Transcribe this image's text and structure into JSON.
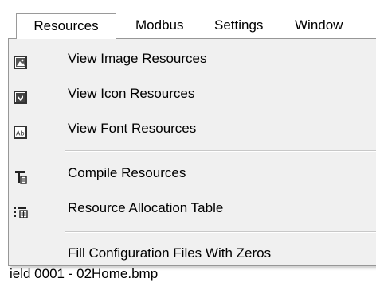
{
  "menubar": {
    "items": [
      "Resources",
      "Modbus",
      "Settings",
      "Window"
    ]
  },
  "background": {
    "partial_text": "ield 0001 - 02Home.bmp"
  },
  "dropdown": {
    "items": [
      {
        "label": "View Image Resources",
        "icon": "image-resource-icon"
      },
      {
        "label": "View Icon Resources",
        "icon": "icon-resource-icon"
      },
      {
        "label": "View Font Resources",
        "icon": "font-resource-icon"
      },
      {
        "label": "Compile Resources",
        "icon": "compile-icon"
      },
      {
        "label": "Resource Allocation Table",
        "icon": "table-icon"
      },
      {
        "label": "Fill Configuration Files With Zeros",
        "icon": ""
      }
    ]
  }
}
